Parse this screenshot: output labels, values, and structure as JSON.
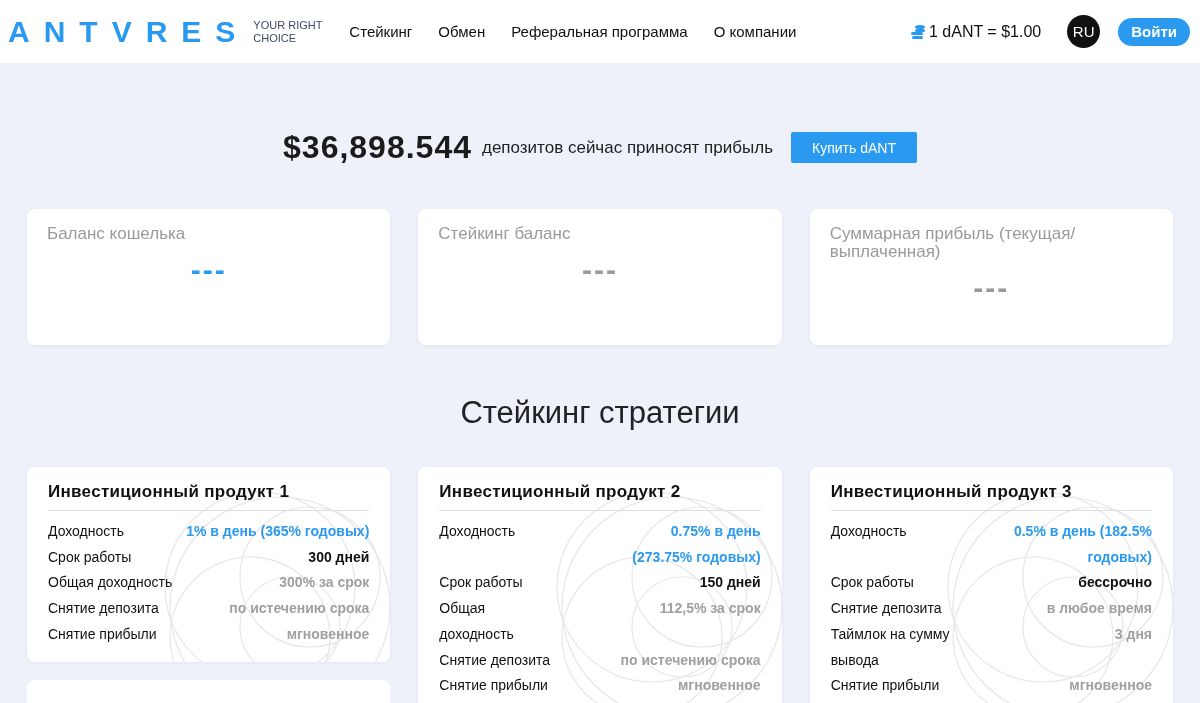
{
  "header": {
    "logo": "ANTVRES",
    "tagline": [
      "YOUR RIGHT",
      "CHOICE"
    ],
    "nav": [
      "Стейкинг",
      "Обмен",
      "Реферальная программа",
      "О компании"
    ],
    "rate": "1 dANT = $1.00",
    "language": "RU",
    "login": "Войти"
  },
  "hero": {
    "amount": "$36,898.544",
    "caption": "депозитов сейчас приносят прибыль",
    "button": "Купить dANT"
  },
  "stats": [
    {
      "title": "Баланс кошелька",
      "value": "---",
      "highlighted": true
    },
    {
      "title": "Стейкинг баланс",
      "value": "---",
      "highlighted": false
    },
    {
      "title": "Суммарная прибыль (текущая/ выплаченная)",
      "value": "---",
      "highlighted": false
    }
  ],
  "section_title": "Стейкинг стратегии",
  "products": [
    {
      "title": "Инвестиционный продукт 1",
      "rows": [
        {
          "label": "Доходность",
          "value": "1% в день (365% годовых)",
          "kind": "accent"
        },
        {
          "label": "Срок работы",
          "value": "300 дней",
          "kind": "strong"
        },
        {
          "label": "Общая доходность",
          "value": "300% за срок",
          "kind": "muted"
        },
        {
          "label": "Снятие депозита",
          "value": "по истечению срока",
          "kind": "muted"
        },
        {
          "label": "Снятие прибыли",
          "value": "мгновенное",
          "kind": "muted"
        }
      ]
    },
    {
      "title": "Инвестиционный продукт 2",
      "rows": [
        {
          "label": "Доходность",
          "value": "0.75% в день (273.75% годовых)",
          "kind": "accent"
        },
        {
          "label": "Срок работы",
          "value": "150 дней",
          "kind": "strong"
        },
        {
          "label": "Общая доходность",
          "value": "112,5% за срок",
          "kind": "muted"
        },
        {
          "label": "Снятие депозита",
          "value": "по истечению срока",
          "kind": "muted"
        },
        {
          "label": "Снятие прибыли",
          "value": "мгновенное",
          "kind": "muted"
        }
      ]
    },
    {
      "title": "Инвестиционный продукт 3",
      "rows": [
        {
          "label": "Доходность",
          "value": "0.5% в день (182.5% годовых)",
          "kind": "accent"
        },
        {
          "label": "Срок работы",
          "value": "бессрочно",
          "kind": "strong"
        },
        {
          "label": "Снятие депозита",
          "value": "в любое время",
          "kind": "muted"
        },
        {
          "label": "Таймлок на сумму вывода",
          "value": "3 дня",
          "kind": "muted"
        },
        {
          "label": "Снятие прибыли",
          "value": "мгновенное",
          "kind": "muted"
        }
      ]
    }
  ]
}
